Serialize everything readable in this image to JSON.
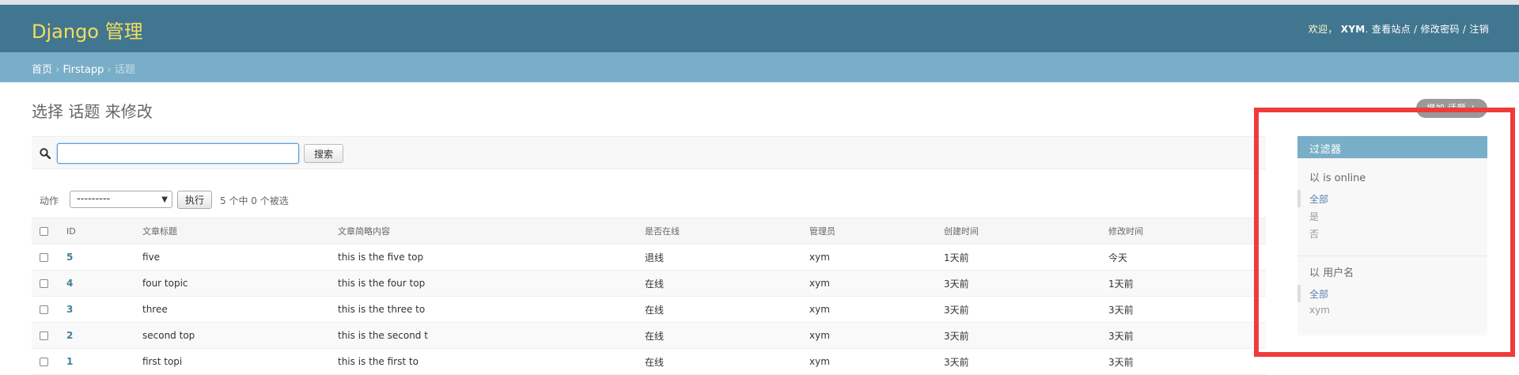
{
  "header": {
    "brand": "Django 管理",
    "welcome": "欢迎，",
    "username": "XYM",
    "view_site": "查看站点",
    "change_password": "修改密码",
    "logout": "注销"
  },
  "breadcrumbs": {
    "home": "首页",
    "app": "Firstapp",
    "current": "话题"
  },
  "page": {
    "title": "选择 话题 来修改",
    "add_button": "增加 话题 +"
  },
  "search": {
    "value": "",
    "button": "搜索"
  },
  "actions": {
    "label": "动作",
    "selected_option": "---------",
    "go_button": "执行",
    "count_text": "5 个中 0 个被选"
  },
  "table": {
    "columns": [
      "ID",
      "文章标题",
      "文章简略内容",
      "是否在线",
      "管理员",
      "创建时间",
      "修改时间"
    ],
    "rows": [
      {
        "id": "5",
        "title": "five",
        "brief": "this is the five top",
        "online": "退线",
        "admin": "xym",
        "created": "1天前",
        "modified": "今天"
      },
      {
        "id": "4",
        "title": "four topic",
        "brief": "this is the four top",
        "online": "在线",
        "admin": "xym",
        "created": "3天前",
        "modified": "1天前"
      },
      {
        "id": "3",
        "title": "three",
        "brief": "this is the three to",
        "online": "在线",
        "admin": "xym",
        "created": "3天前",
        "modified": "3天前"
      },
      {
        "id": "2",
        "title": "second top",
        "brief": "this is the second t",
        "online": "在线",
        "admin": "xym",
        "created": "3天前",
        "modified": "3天前"
      },
      {
        "id": "1",
        "title": "first topi",
        "brief": "this is the first to",
        "online": "在线",
        "admin": "xym",
        "created": "3天前",
        "modified": "3天前"
      }
    ]
  },
  "filter": {
    "title": "过滤器",
    "groups": [
      {
        "title": "以 is online",
        "options": [
          "全部",
          "是",
          "否"
        ],
        "selected": 0
      },
      {
        "title": "以 用户名",
        "options": [
          "全部",
          "xym"
        ],
        "selected": 0
      }
    ]
  },
  "colors": {
    "header_bg": "#417690",
    "brand": "#f5dd5d",
    "breadcrumb_bg": "#79aec8",
    "link": "#447e9b",
    "highlight_border": "#f03b3b"
  }
}
